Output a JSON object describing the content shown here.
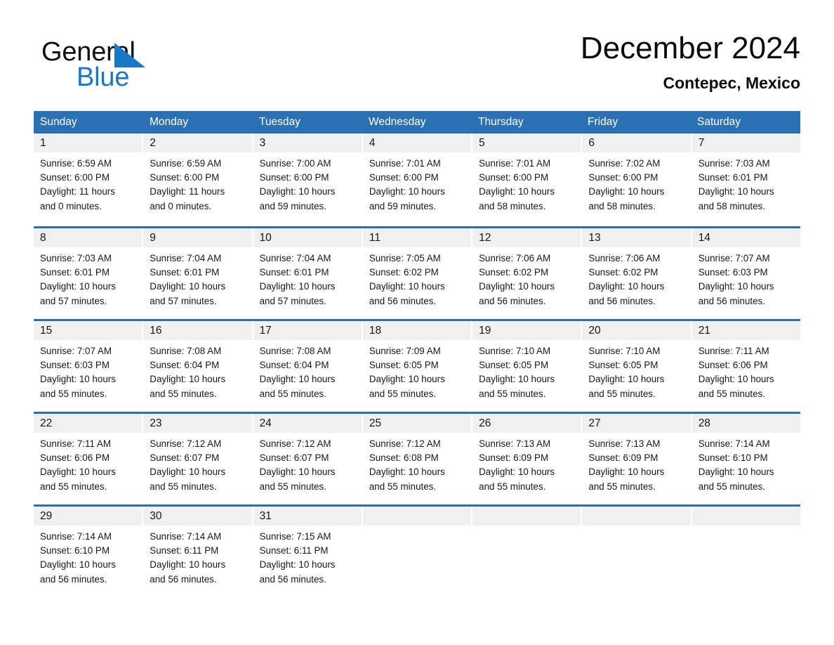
{
  "brand": {
    "name_part1": "General",
    "name_part2": "Blue",
    "triangle_color": "#1878c8",
    "blue_text_color": "#1878c8"
  },
  "header": {
    "title": "December 2024",
    "subtitle": "Contepec, Mexico"
  },
  "colors": {
    "header_blue": "#2b70b2",
    "daynum_band": "#f0f0f0",
    "text": "#171717"
  },
  "calendar": {
    "weekdays": [
      "Sunday",
      "Monday",
      "Tuesday",
      "Wednesday",
      "Thursday",
      "Friday",
      "Saturday"
    ],
    "weeks": [
      [
        {
          "day": "1",
          "sunrise": "Sunrise: 6:59 AM",
          "sunset": "Sunset: 6:00 PM",
          "daylight_line1": "Daylight: 11 hours",
          "daylight_line2": "and 0 minutes."
        },
        {
          "day": "2",
          "sunrise": "Sunrise: 6:59 AM",
          "sunset": "Sunset: 6:00 PM",
          "daylight_line1": "Daylight: 11 hours",
          "daylight_line2": "and 0 minutes."
        },
        {
          "day": "3",
          "sunrise": "Sunrise: 7:00 AM",
          "sunset": "Sunset: 6:00 PM",
          "daylight_line1": "Daylight: 10 hours",
          "daylight_line2": "and 59 minutes."
        },
        {
          "day": "4",
          "sunrise": "Sunrise: 7:01 AM",
          "sunset": "Sunset: 6:00 PM",
          "daylight_line1": "Daylight: 10 hours",
          "daylight_line2": "and 59 minutes."
        },
        {
          "day": "5",
          "sunrise": "Sunrise: 7:01 AM",
          "sunset": "Sunset: 6:00 PM",
          "daylight_line1": "Daylight: 10 hours",
          "daylight_line2": "and 58 minutes."
        },
        {
          "day": "6",
          "sunrise": "Sunrise: 7:02 AM",
          "sunset": "Sunset: 6:00 PM",
          "daylight_line1": "Daylight: 10 hours",
          "daylight_line2": "and 58 minutes."
        },
        {
          "day": "7",
          "sunrise": "Sunrise: 7:03 AM",
          "sunset": "Sunset: 6:01 PM",
          "daylight_line1": "Daylight: 10 hours",
          "daylight_line2": "and 58 minutes."
        }
      ],
      [
        {
          "day": "8",
          "sunrise": "Sunrise: 7:03 AM",
          "sunset": "Sunset: 6:01 PM",
          "daylight_line1": "Daylight: 10 hours",
          "daylight_line2": "and 57 minutes."
        },
        {
          "day": "9",
          "sunrise": "Sunrise: 7:04 AM",
          "sunset": "Sunset: 6:01 PM",
          "daylight_line1": "Daylight: 10 hours",
          "daylight_line2": "and 57 minutes."
        },
        {
          "day": "10",
          "sunrise": "Sunrise: 7:04 AM",
          "sunset": "Sunset: 6:01 PM",
          "daylight_line1": "Daylight: 10 hours",
          "daylight_line2": "and 57 minutes."
        },
        {
          "day": "11",
          "sunrise": "Sunrise: 7:05 AM",
          "sunset": "Sunset: 6:02 PM",
          "daylight_line1": "Daylight: 10 hours",
          "daylight_line2": "and 56 minutes."
        },
        {
          "day": "12",
          "sunrise": "Sunrise: 7:06 AM",
          "sunset": "Sunset: 6:02 PM",
          "daylight_line1": "Daylight: 10 hours",
          "daylight_line2": "and 56 minutes."
        },
        {
          "day": "13",
          "sunrise": "Sunrise: 7:06 AM",
          "sunset": "Sunset: 6:02 PM",
          "daylight_line1": "Daylight: 10 hours",
          "daylight_line2": "and 56 minutes."
        },
        {
          "day": "14",
          "sunrise": "Sunrise: 7:07 AM",
          "sunset": "Sunset: 6:03 PM",
          "daylight_line1": "Daylight: 10 hours",
          "daylight_line2": "and 56 minutes."
        }
      ],
      [
        {
          "day": "15",
          "sunrise": "Sunrise: 7:07 AM",
          "sunset": "Sunset: 6:03 PM",
          "daylight_line1": "Daylight: 10 hours",
          "daylight_line2": "and 55 minutes."
        },
        {
          "day": "16",
          "sunrise": "Sunrise: 7:08 AM",
          "sunset": "Sunset: 6:04 PM",
          "daylight_line1": "Daylight: 10 hours",
          "daylight_line2": "and 55 minutes."
        },
        {
          "day": "17",
          "sunrise": "Sunrise: 7:08 AM",
          "sunset": "Sunset: 6:04 PM",
          "daylight_line1": "Daylight: 10 hours",
          "daylight_line2": "and 55 minutes."
        },
        {
          "day": "18",
          "sunrise": "Sunrise: 7:09 AM",
          "sunset": "Sunset: 6:05 PM",
          "daylight_line1": "Daylight: 10 hours",
          "daylight_line2": "and 55 minutes."
        },
        {
          "day": "19",
          "sunrise": "Sunrise: 7:10 AM",
          "sunset": "Sunset: 6:05 PM",
          "daylight_line1": "Daylight: 10 hours",
          "daylight_line2": "and 55 minutes."
        },
        {
          "day": "20",
          "sunrise": "Sunrise: 7:10 AM",
          "sunset": "Sunset: 6:05 PM",
          "daylight_line1": "Daylight: 10 hours",
          "daylight_line2": "and 55 minutes."
        },
        {
          "day": "21",
          "sunrise": "Sunrise: 7:11 AM",
          "sunset": "Sunset: 6:06 PM",
          "daylight_line1": "Daylight: 10 hours",
          "daylight_line2": "and 55 minutes."
        }
      ],
      [
        {
          "day": "22",
          "sunrise": "Sunrise: 7:11 AM",
          "sunset": "Sunset: 6:06 PM",
          "daylight_line1": "Daylight: 10 hours",
          "daylight_line2": "and 55 minutes."
        },
        {
          "day": "23",
          "sunrise": "Sunrise: 7:12 AM",
          "sunset": "Sunset: 6:07 PM",
          "daylight_line1": "Daylight: 10 hours",
          "daylight_line2": "and 55 minutes."
        },
        {
          "day": "24",
          "sunrise": "Sunrise: 7:12 AM",
          "sunset": "Sunset: 6:07 PM",
          "daylight_line1": "Daylight: 10 hours",
          "daylight_line2": "and 55 minutes."
        },
        {
          "day": "25",
          "sunrise": "Sunrise: 7:12 AM",
          "sunset": "Sunset: 6:08 PM",
          "daylight_line1": "Daylight: 10 hours",
          "daylight_line2": "and 55 minutes."
        },
        {
          "day": "26",
          "sunrise": "Sunrise: 7:13 AM",
          "sunset": "Sunset: 6:09 PM",
          "daylight_line1": "Daylight: 10 hours",
          "daylight_line2": "and 55 minutes."
        },
        {
          "day": "27",
          "sunrise": "Sunrise: 7:13 AM",
          "sunset": "Sunset: 6:09 PM",
          "daylight_line1": "Daylight: 10 hours",
          "daylight_line2": "and 55 minutes."
        },
        {
          "day": "28",
          "sunrise": "Sunrise: 7:14 AM",
          "sunset": "Sunset: 6:10 PM",
          "daylight_line1": "Daylight: 10 hours",
          "daylight_line2": "and 55 minutes."
        }
      ],
      [
        {
          "day": "29",
          "sunrise": "Sunrise: 7:14 AM",
          "sunset": "Sunset: 6:10 PM",
          "daylight_line1": "Daylight: 10 hours",
          "daylight_line2": "and 56 minutes."
        },
        {
          "day": "30",
          "sunrise": "Sunrise: 7:14 AM",
          "sunset": "Sunset: 6:11 PM",
          "daylight_line1": "Daylight: 10 hours",
          "daylight_line2": "and 56 minutes."
        },
        {
          "day": "31",
          "sunrise": "Sunrise: 7:15 AM",
          "sunset": "Sunset: 6:11 PM",
          "daylight_line1": "Daylight: 10 hours",
          "daylight_line2": "and 56 minutes."
        },
        {
          "day": "",
          "sunrise": "",
          "sunset": "",
          "daylight_line1": "",
          "daylight_line2": ""
        },
        {
          "day": "",
          "sunrise": "",
          "sunset": "",
          "daylight_line1": "",
          "daylight_line2": ""
        },
        {
          "day": "",
          "sunrise": "",
          "sunset": "",
          "daylight_line1": "",
          "daylight_line2": ""
        },
        {
          "day": "",
          "sunrise": "",
          "sunset": "",
          "daylight_line1": "",
          "daylight_line2": ""
        }
      ]
    ]
  }
}
